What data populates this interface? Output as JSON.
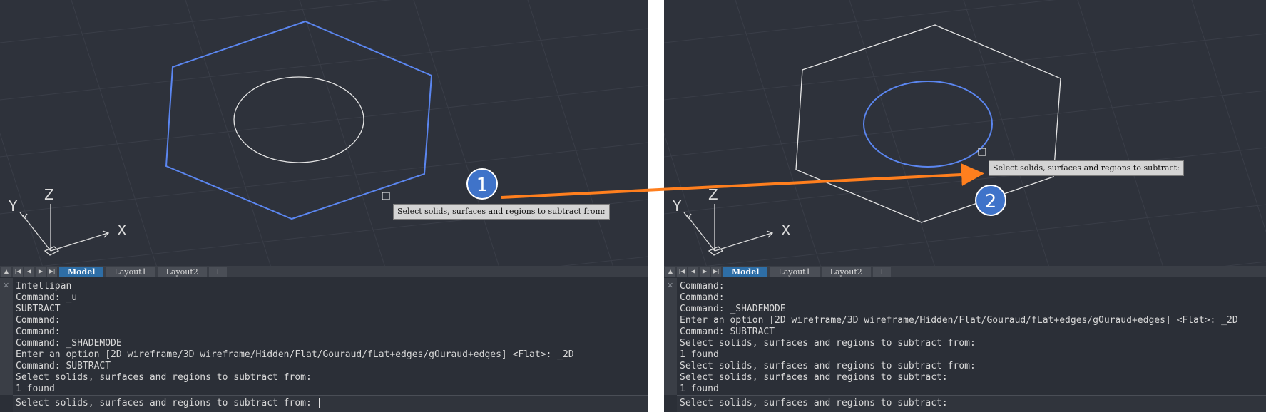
{
  "left": {
    "tooltip": "Select solids, surfaces and regions to subtract from:",
    "tabs": [
      "Model",
      "Layout1",
      "Layout2",
      "+"
    ],
    "history": [
      "Intellipan",
      "Command: _u",
      "SUBTRACT",
      "Command:",
      "Command:",
      "Command: _SHADEMODE",
      "Enter an option [2D wireframe/3D wireframe/Hidden/Flat/Gouraud/fLat+edges/gOuraud+edges] <Flat>: _2D",
      "Command: SUBTRACT",
      "Select solids, surfaces and regions to subtract from:",
      "1 found"
    ],
    "prompt": "Select solids, surfaces and regions to subtract from: "
  },
  "right": {
    "tooltip": "Select solids, surfaces and regions to subtract:",
    "tabs": [
      "Model",
      "Layout1",
      "Layout2",
      "+"
    ],
    "history": [
      "Command:",
      "Command:",
      "Command: _SHADEMODE",
      "Enter an option [2D wireframe/3D wireframe/Hidden/Flat/Gouraud/fLat+edges/gOuraud+edges] <Flat>: _2D",
      "Command: SUBTRACT",
      "Select solids, surfaces and regions to subtract from:",
      "1 found",
      "Select solids, surfaces and regions to subtract from:",
      "Select solids, surfaces and regions to subtract:",
      "1 found"
    ],
    "prompt": "Select solids, surfaces and regions to subtract:"
  },
  "ucs": {
    "x": "X",
    "y": "Y",
    "z": "Z"
  },
  "nav_icons": [
    "nav-up-icon",
    "nav-first-icon",
    "nav-prev-icon",
    "nav-next-icon",
    "nav-last-icon"
  ],
  "nav_glyphs": [
    "▲",
    "|◀",
    "◀",
    "▶",
    "▶|"
  ],
  "callouts": {
    "step1": "1",
    "step2": "2"
  },
  "colors": {
    "viewport_bg": "#2e323b",
    "selected": "#5b86f0",
    "wire": "#e6e6e6",
    "arrow": "#ff7f1e",
    "badge": "#3f73c9"
  }
}
